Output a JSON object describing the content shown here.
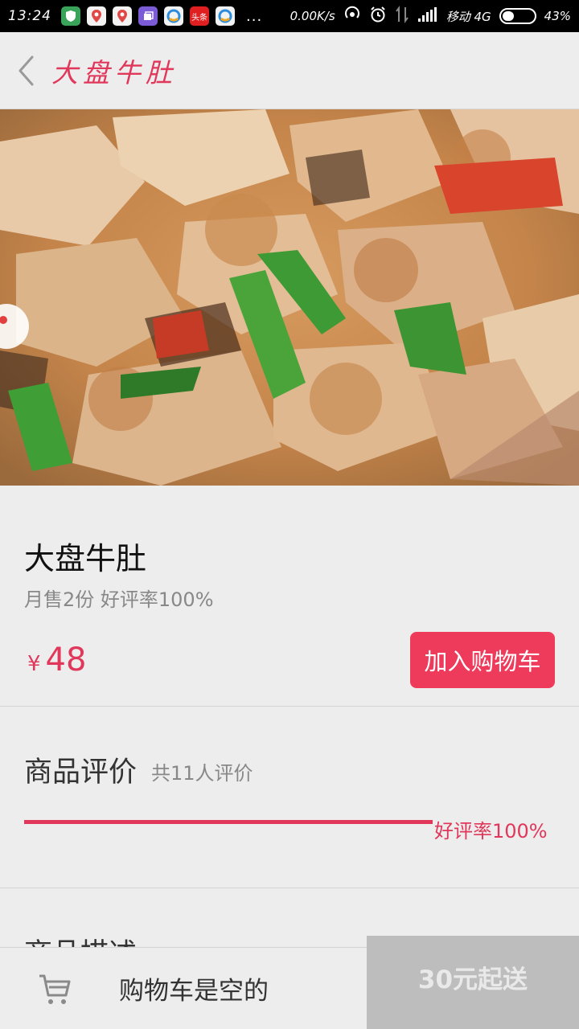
{
  "status_bar": {
    "time": "13:24",
    "dots": "...",
    "network_speed": "0.00K/s",
    "carrier": "移动 4G",
    "battery_percent": "43%",
    "battery_level": 0.43,
    "notification_icon_labels": [
      "头条"
    ]
  },
  "header": {
    "back_icon": "chevron-left-icon",
    "title": "大盘牛肚"
  },
  "product": {
    "name": "大盘牛肚",
    "stats": "月售2份 好评率100%",
    "price_symbol": "¥",
    "price": "48",
    "add_to_cart_label": "加入购物车"
  },
  "reviews": {
    "title": "商品评价",
    "count_text": "共11人评价",
    "positive_rate_label": "好评率100%",
    "positive_rate": 1.0
  },
  "description": {
    "title": "商品描述"
  },
  "cart_bar": {
    "cart_icon": "shopping-cart-icon",
    "empty_text": "购物车是空的",
    "min_order_text": "30元起送"
  },
  "colors": {
    "accent": "#e0375a",
    "button": "#ee3a5b",
    "min_order_bg": "#bdbdbd"
  }
}
